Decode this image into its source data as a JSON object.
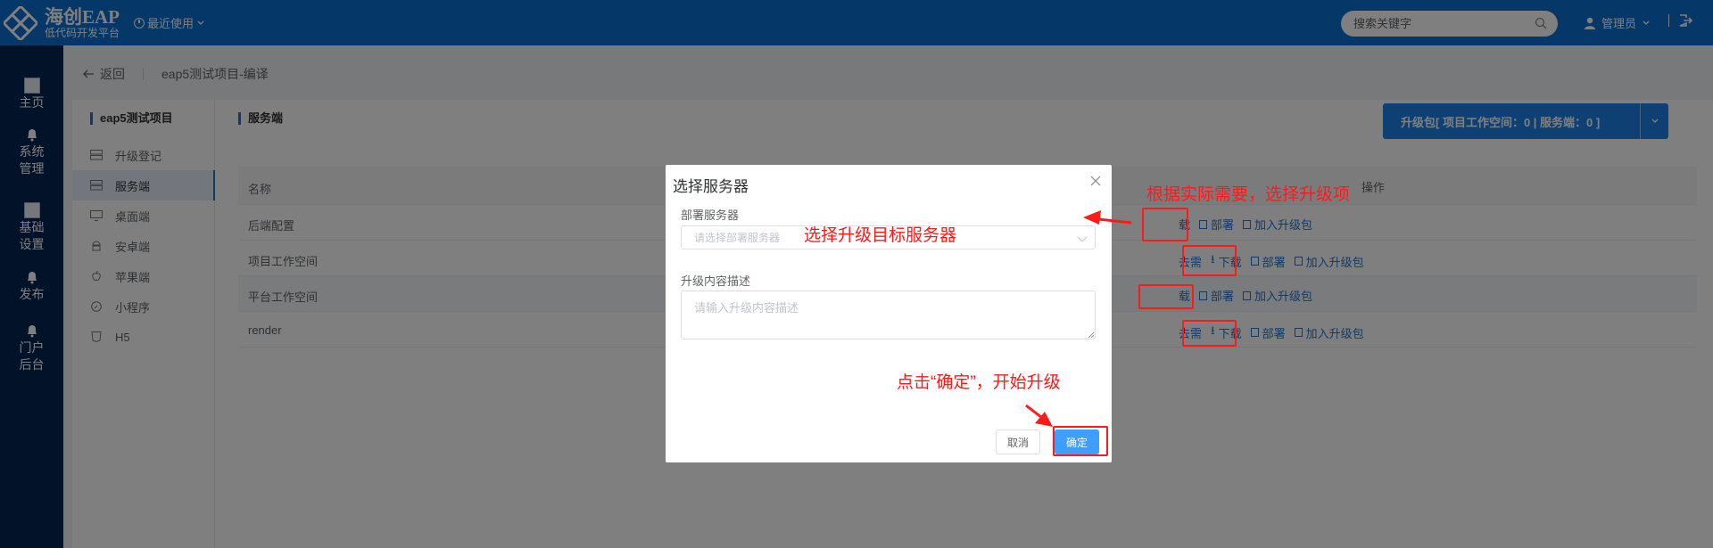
{
  "header": {
    "logo_title": "海创EAP",
    "logo_subtitle": "低代码开发平台",
    "recent_label": "最近使用",
    "search_placeholder": "搜索关键字",
    "user_label": "管理员",
    "brand_color": "#0a6fd1"
  },
  "sidenav": {
    "items": [
      {
        "label": "主页",
        "icon": "image-icon"
      },
      {
        "label": "系统管理",
        "icon": "bell-icon"
      },
      {
        "label": "基础设置",
        "icon": "image-icon"
      },
      {
        "label": "发布",
        "icon": "bell-icon"
      },
      {
        "label": "门户后台",
        "icon": "bell-icon"
      }
    ]
  },
  "breadcrumb": {
    "back_label": "返回",
    "page_label": "eap5测试项目-编译"
  },
  "tree": {
    "title": "eap5测试项目",
    "items": [
      {
        "label": "升级登记",
        "icon": "server-icon"
      },
      {
        "label": "服务端",
        "icon": "server-icon"
      },
      {
        "label": "桌面端",
        "icon": "monitor-icon"
      },
      {
        "label": "安卓端",
        "icon": "android-icon"
      },
      {
        "label": "苹果端",
        "icon": "apple-icon"
      },
      {
        "label": "小程序",
        "icon": "compass-icon"
      },
      {
        "label": "H5",
        "icon": "h5-icon"
      }
    ]
  },
  "main": {
    "title": "服务端",
    "upgrade_button": "升级包[ 项目工作空间：0 | 服务端：0 ]",
    "table": {
      "col_name": "名称",
      "col_op": "操作",
      "rows": [
        {
          "name": "后端配置",
          "ops": [
            "载",
            "部署",
            "加入升级包"
          ]
        },
        {
          "name": "项目工作空间",
          "ops": [
            "去需",
            "下载",
            "部署",
            "加入升级包"
          ]
        },
        {
          "name": "平台工作空间",
          "ops": [
            "载",
            "部署",
            "加入升级包"
          ]
        },
        {
          "name": "render",
          "ops": [
            "去需",
            "下载",
            "部署",
            "加入升级包"
          ]
        }
      ]
    }
  },
  "dialog": {
    "title": "选择服务器",
    "server_label": "部署服务器",
    "server_placeholder": "请选择部署服务器",
    "desc_label": "升级内容描述",
    "desc_placeholder": "请输入升级内容描述",
    "cancel_label": "取消",
    "ok_label": "确定"
  },
  "annotations": {
    "choose_item": "根据实际需要，选择升级项",
    "choose_server": "选择升级目标服务器",
    "click_ok": "点击“确定”，开始升级",
    "color": "#ff1a1a"
  }
}
